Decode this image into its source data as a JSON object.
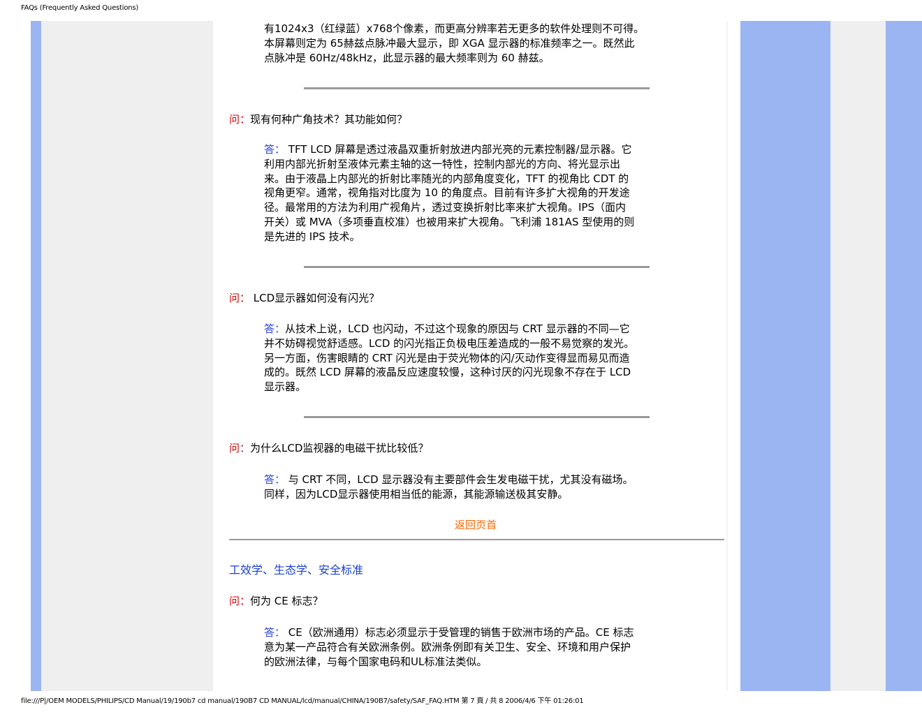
{
  "header": {
    "title": "FAQs (Frequently Asked Questions)"
  },
  "footer": {
    "path": "file:///P|/OEM MODELS/PHILIPS/CD Manual/19/190b7 cd manual/190B7 CD MANUAL/lcd/manual/CHINA/190B7/safety/SAF_FAQ.HTM 第 7 頁 / 共 8 2006/4/6 下午 01:26:01"
  },
  "intro": {
    "lines": [
      "有1024x3（红绿蓝）x768个像素，而更高分辨率若无更多的软件处理则不可得。",
      "本屏幕则定为 65赫兹点脉冲最大显示，即 XGA 显示器的标准频率之一。既然此",
      "点脉冲是 60Hz/48kHz，此显示器的最大频率则为 60 赫兹。"
    ]
  },
  "faq": [
    {
      "q_label": "问：",
      "question": "现有何种广角技术？其功能如何？",
      "a_label": "答：",
      "answer_lines": [
        " TFT LCD 屏幕是透过液晶双重折射放进内部光亮的元素控制器/显示器。它",
        "利用内部光折射至液体元素主轴的这一特性，控制内部光的方向、将光显示出",
        "来。由于液晶上内部光的折射比率随光的内部角度变化，TFT 的视角比 CDT 的",
        "视角更窄。通常，视角指对比度为 10 的角度点。目前有许多扩大视角的开发途",
        "径。最常用的方法为利用广视角片，透过变换折射比率来扩大视角。IPS（面内",
        "开关）或 MVA（多项垂直校准）也被用来扩大视角。飞利浦 181AS 型使用的则",
        "是先进的 IPS 技术。"
      ]
    },
    {
      "q_label": "问：",
      "question": " LCD显示器如何没有闪光？",
      "a_label": "答：",
      "answer_lines": [
        "从技术上说，LCD 也闪动，不过这个现象的原因与 CRT 显示器的不同—它",
        "并不妨碍视觉舒适感。LCD 的闪光指正负极电压差造成的一般不易觉察的发光。",
        "另一方面，伤害眼睛的 CRT 闪光是由于荧光物体的闪/灭动作变得显而易见而造",
        "成的。既然 LCD 屏幕的液晶反应速度较慢，这种讨厌的闪光现象不存在于 LCD",
        "显示器。"
      ]
    },
    {
      "q_label": "问：",
      "question": "为什么LCD监视器的电磁干扰比较低？",
      "a_label": "答：",
      "answer_lines": [
        " 与 CRT 不同，LCD 显示器没有主要部件会生发电磁干扰，尤其没有磁场。",
        "同样，因为LCD显示器使用相当低的能源，其能源输送极其安静。"
      ]
    }
  ],
  "back_to_top": "返回页首",
  "section": {
    "title": "工效学、生态学、安全标准",
    "q_label": "问：",
    "question": "何为 CE 标志？",
    "a_label": "答：",
    "answer_lines": [
      " CE（欧洲通用）标志必须显示于受管理的销售于欧洲市场的产品。CE 标志",
      "意为某一产品符合有关欧洲条例。欧洲条例即有关卫生、安全、环境和用户保护",
      "的欧洲法律，与每个国家电码和UL标准法类似。"
    ]
  },
  "colors": {
    "question_label": "#d40000",
    "answer_label": "#2b45d8",
    "back_link": "#ff6600",
    "section_title": "#1a3fd0",
    "side_blue": "#9bb4f2",
    "side_gray": "#efefef"
  }
}
